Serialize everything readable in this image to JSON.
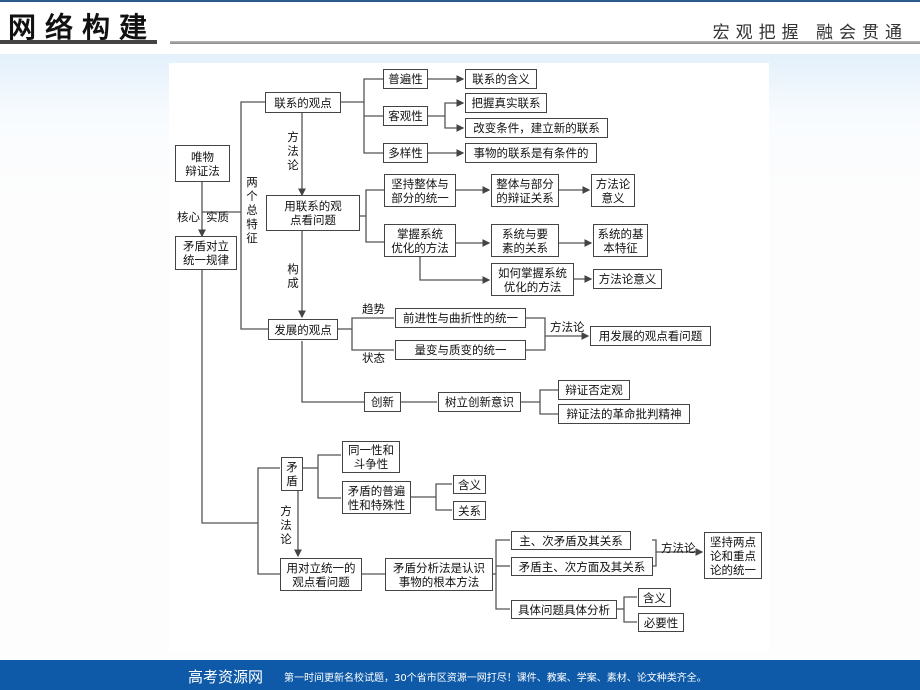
{
  "header": {
    "title": "网络构建",
    "slogan": "宏观把握  融会贯通"
  },
  "nodes": {
    "root": "唯物\n辩证法",
    "law": "矛盾对立\n统一规律",
    "connection_view": "联系的观点",
    "universality": "普遍性",
    "objectivity": "客观性",
    "diversity": "多样性",
    "meaning_connection": "联系的含义",
    "grasp_real": "把握真实联系",
    "change_conditions": "改变条件，建立新的联系",
    "conditional": "事物的联系是有条件的",
    "use_connection": "用联系的观\n点看问题",
    "whole_part_unity": "坚持整体与\n部分的统一",
    "whole_part_dialectic": "整体与部分\n的辩证关系",
    "methodology_meaning_1": "方法论\n意义",
    "system_optimize": "掌握系统\n优化的方法",
    "system_elements": "系统与要\n素的关系",
    "system_features": "系统的基\n本特征",
    "how_system_optimize": "如何掌握系统\n优化的方法",
    "methodology_meaning_2": "方法论意义",
    "development_view": "发展的观点",
    "progress_twist": "前进性与曲折性的统一",
    "quantity_quality": "量变与质变的统一",
    "use_development": "用发展的观点看问题",
    "innovation": "创新",
    "innovation_awareness": "树立创新意识",
    "dialectical_negation": "辩证否定观",
    "revolutionary_spirit": "辩证法的革命批判精神",
    "contradiction": "矛\n盾",
    "identity_struggle": "同一性和\n斗争性",
    "universal_particular": "矛盾的普遍\n性和特殊性",
    "meaning": "含义",
    "relation": "关系",
    "use_unity_opposites": "用对立统一的\n观点看问题",
    "contradiction_analysis": "矛盾分析法是认识\n事物的根本方法",
    "main_secondary": "主、次矛盾及其关系",
    "main_secondary_aspects": "矛盾主、次方面及其关系",
    "two_points_focus": "坚持两点\n论和重点\n论的统一",
    "concrete_analysis": "具体问题具体分析",
    "meaning_2": "含义",
    "necessity": "必要性"
  },
  "labels": {
    "core": "核心",
    "essence": "实质",
    "two_features": "两\n个\n总\n特\n征",
    "methodology_1": "方\n法\n论",
    "constitutes": "构\n成",
    "trend": "趋势",
    "state": "状态",
    "methodology_2": "方法论",
    "methodology_3": "方\n法\n论",
    "methodology_4": "方法论"
  },
  "footer": {
    "brand": "高考资源网",
    "tagline": "第一时间更新名校试题，30个省市区资源一网打尽！课件、教案、学案、素材、论文种类齐全。"
  },
  "colors": {
    "footer_bg": "#0e5aa8",
    "line": "#555555",
    "box_border": "#444444"
  }
}
